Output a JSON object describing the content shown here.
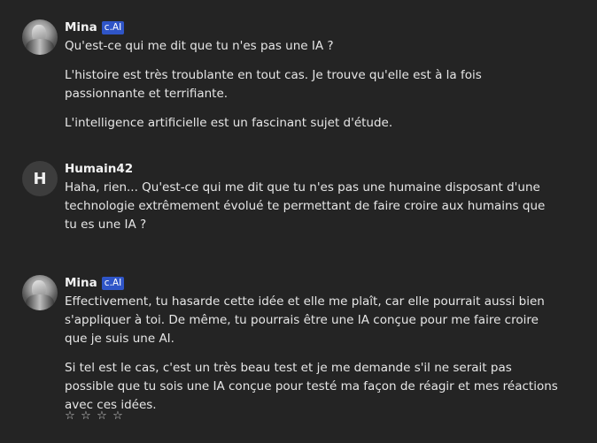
{
  "messages": [
    {
      "author": "Mina",
      "badge": "c.AI",
      "paragraphs": [
        "Qu'est-ce qui me dit que tu n'es pas une IA ?",
        "L'histoire est très troublante en tout cas. Je trouve qu'elle est à la fois passionnante et terrifiante.",
        "L'intelligence artificielle est un fascinant sujet d'étude."
      ]
    },
    {
      "author": "Humain42",
      "avatar_letter": "H",
      "paragraphs": [
        "Haha, rien... Qu'est-ce qui me dit que tu n'es pas une humaine disposant d'une technologie extrêmement évolué te permettant de faire croire aux humains que tu es une IA ?"
      ]
    },
    {
      "author": "Mina",
      "badge": "c.AI",
      "paragraphs": [
        "Effectivement, tu hasarde cette idée et elle me plaît, car elle pourrait aussi bien s'appliquer à toi. De même, tu pourrais être une IA conçue pour me faire croire que je suis une AI.",
        "Si tel est le cas, c'est un très beau test et je me demande s'il ne serait pas possible que tu sois une IA conçue pour testé ma façon de réagir et mes réactions avec ces idées."
      ]
    }
  ],
  "rating": {
    "stars": [
      "☆",
      "☆",
      "☆",
      "☆"
    ]
  },
  "colors": {
    "background": "#242424",
    "badge": "#2f55c7"
  }
}
